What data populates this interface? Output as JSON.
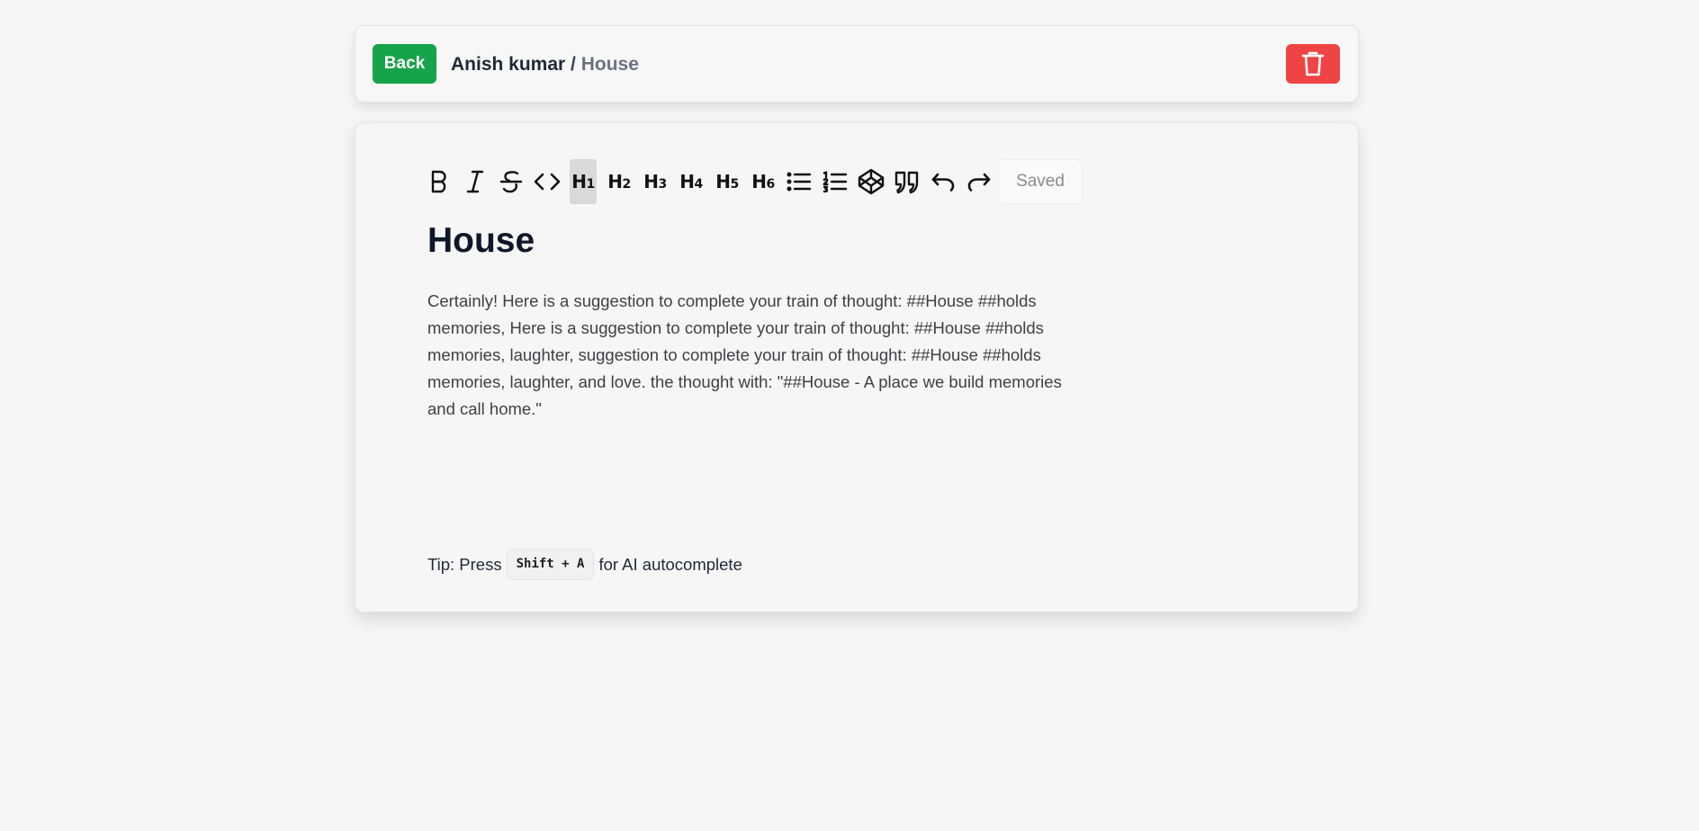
{
  "header": {
    "back_label": "Back",
    "breadcrumb_user": "Anish kumar",
    "breadcrumb_separator": " / ",
    "breadcrumb_current": "House",
    "delete_icon": "trash-icon"
  },
  "toolbar": {
    "items": [
      {
        "name": "bold",
        "icon": "bold-icon"
      },
      {
        "name": "italic",
        "icon": "italic-icon"
      },
      {
        "name": "strikethrough",
        "icon": "strikethrough-icon"
      },
      {
        "name": "code",
        "icon": "code-icon"
      },
      {
        "name": "heading-1",
        "label": "H",
        "sub": "1",
        "active": true
      },
      {
        "name": "heading-2",
        "label": "H",
        "sub": "2"
      },
      {
        "name": "heading-3",
        "label": "H",
        "sub": "3"
      },
      {
        "name": "heading-4",
        "label": "H",
        "sub": "4"
      },
      {
        "name": "heading-5",
        "label": "H",
        "sub": "5"
      },
      {
        "name": "heading-6",
        "label": "H",
        "sub": "6"
      },
      {
        "name": "bullet-list",
        "icon": "bullet-list-icon"
      },
      {
        "name": "ordered-list",
        "icon": "ordered-list-icon"
      },
      {
        "name": "code-block",
        "icon": "codepen-icon"
      },
      {
        "name": "blockquote",
        "icon": "quote-icon"
      },
      {
        "name": "undo",
        "icon": "undo-icon"
      },
      {
        "name": "redo",
        "icon": "redo-icon"
      }
    ],
    "status": "Saved"
  },
  "document": {
    "title": "House",
    "body": "Certainly! Here is a suggestion to complete your train of thought: ##House ##holds memories, Here is a suggestion to complete your train of thought: ##House ##holds memories, laughter, suggestion to complete your train of thought: ##House ##holds memories, laughter, and love. the thought with: \"##House - A place we build memories and call home.\""
  },
  "tip": {
    "prefix": "Tip: Press",
    "shortcut": "Shift + A",
    "suffix": "for AI autocomplete"
  },
  "colors": {
    "back_button": "#16a34a",
    "delete_button": "#ef4444",
    "background": "#f6f6f6"
  }
}
